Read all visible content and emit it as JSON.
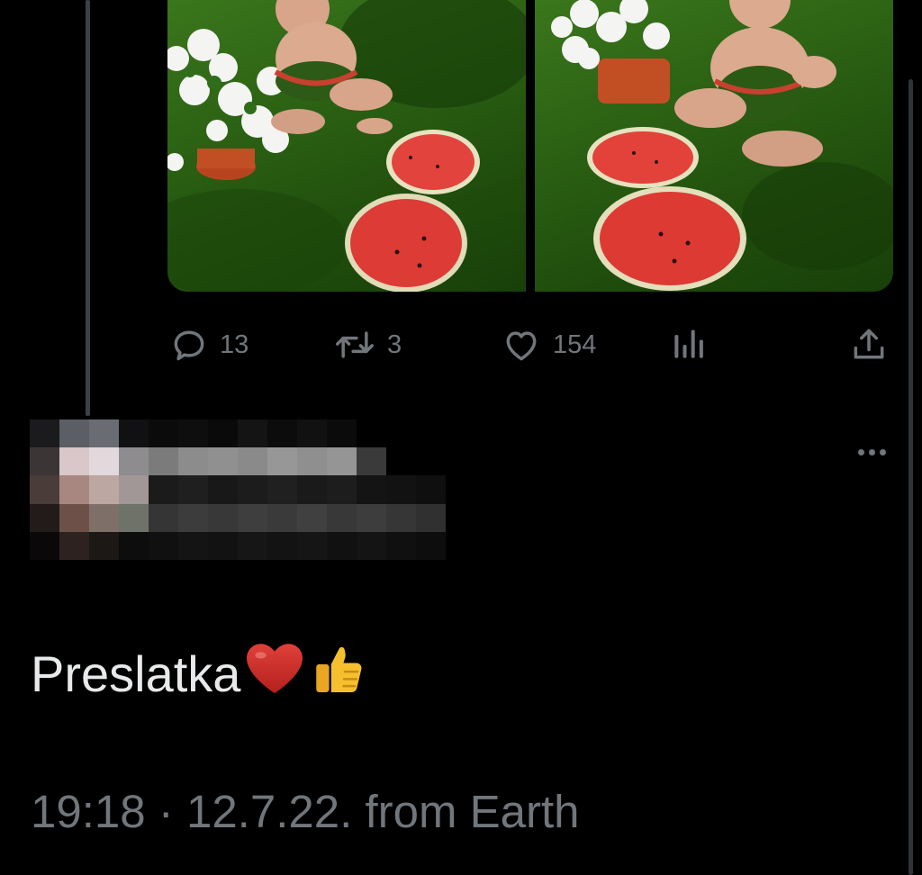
{
  "tweet": {
    "actions": {
      "reply": {
        "icon": "reply-icon",
        "count": "13"
      },
      "retweet": {
        "icon": "retweet-icon",
        "count": "3"
      },
      "like": {
        "icon": "like-icon",
        "count": "154"
      },
      "views": {
        "icon": "views-icon"
      },
      "share": {
        "icon": "share-icon"
      }
    }
  },
  "reply": {
    "author_redacted": true,
    "more_icon": "more-options-icon",
    "text": "Preslatka",
    "emojis": [
      "heart-emoji",
      "thumbs-up-emoji"
    ],
    "meta": {
      "time": "19:18",
      "separator": " · ",
      "date": "12.7.22.",
      "source": "from Earth"
    }
  },
  "colors": {
    "background": "#000000",
    "text_primary": "#e7e9ea",
    "text_secondary": "#71767b",
    "thread_line": "#3e4144"
  }
}
